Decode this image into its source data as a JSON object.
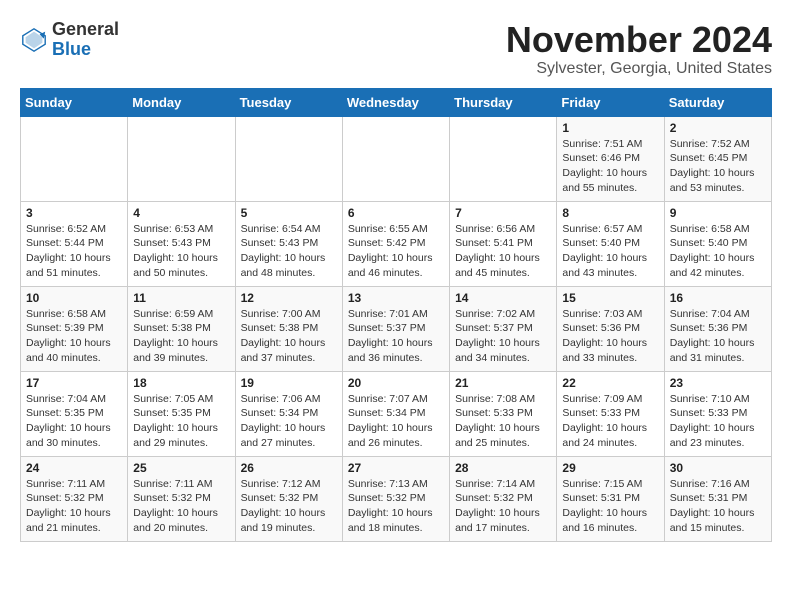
{
  "header": {
    "logo_general": "General",
    "logo_blue": "Blue",
    "title": "November 2024",
    "subtitle": "Sylvester, Georgia, United States"
  },
  "weekdays": [
    "Sunday",
    "Monday",
    "Tuesday",
    "Wednesday",
    "Thursday",
    "Friday",
    "Saturday"
  ],
  "weeks": [
    [
      {
        "day": "",
        "info": ""
      },
      {
        "day": "",
        "info": ""
      },
      {
        "day": "",
        "info": ""
      },
      {
        "day": "",
        "info": ""
      },
      {
        "day": "",
        "info": ""
      },
      {
        "day": "1",
        "info": "Sunrise: 7:51 AM\nSunset: 6:46 PM\nDaylight: 10 hours\nand 55 minutes."
      },
      {
        "day": "2",
        "info": "Sunrise: 7:52 AM\nSunset: 6:45 PM\nDaylight: 10 hours\nand 53 minutes."
      }
    ],
    [
      {
        "day": "3",
        "info": "Sunrise: 6:52 AM\nSunset: 5:44 PM\nDaylight: 10 hours\nand 51 minutes."
      },
      {
        "day": "4",
        "info": "Sunrise: 6:53 AM\nSunset: 5:43 PM\nDaylight: 10 hours\nand 50 minutes."
      },
      {
        "day": "5",
        "info": "Sunrise: 6:54 AM\nSunset: 5:43 PM\nDaylight: 10 hours\nand 48 minutes."
      },
      {
        "day": "6",
        "info": "Sunrise: 6:55 AM\nSunset: 5:42 PM\nDaylight: 10 hours\nand 46 minutes."
      },
      {
        "day": "7",
        "info": "Sunrise: 6:56 AM\nSunset: 5:41 PM\nDaylight: 10 hours\nand 45 minutes."
      },
      {
        "day": "8",
        "info": "Sunrise: 6:57 AM\nSunset: 5:40 PM\nDaylight: 10 hours\nand 43 minutes."
      },
      {
        "day": "9",
        "info": "Sunrise: 6:58 AM\nSunset: 5:40 PM\nDaylight: 10 hours\nand 42 minutes."
      }
    ],
    [
      {
        "day": "10",
        "info": "Sunrise: 6:58 AM\nSunset: 5:39 PM\nDaylight: 10 hours\nand 40 minutes."
      },
      {
        "day": "11",
        "info": "Sunrise: 6:59 AM\nSunset: 5:38 PM\nDaylight: 10 hours\nand 39 minutes."
      },
      {
        "day": "12",
        "info": "Sunrise: 7:00 AM\nSunset: 5:38 PM\nDaylight: 10 hours\nand 37 minutes."
      },
      {
        "day": "13",
        "info": "Sunrise: 7:01 AM\nSunset: 5:37 PM\nDaylight: 10 hours\nand 36 minutes."
      },
      {
        "day": "14",
        "info": "Sunrise: 7:02 AM\nSunset: 5:37 PM\nDaylight: 10 hours\nand 34 minutes."
      },
      {
        "day": "15",
        "info": "Sunrise: 7:03 AM\nSunset: 5:36 PM\nDaylight: 10 hours\nand 33 minutes."
      },
      {
        "day": "16",
        "info": "Sunrise: 7:04 AM\nSunset: 5:36 PM\nDaylight: 10 hours\nand 31 minutes."
      }
    ],
    [
      {
        "day": "17",
        "info": "Sunrise: 7:04 AM\nSunset: 5:35 PM\nDaylight: 10 hours\nand 30 minutes."
      },
      {
        "day": "18",
        "info": "Sunrise: 7:05 AM\nSunset: 5:35 PM\nDaylight: 10 hours\nand 29 minutes."
      },
      {
        "day": "19",
        "info": "Sunrise: 7:06 AM\nSunset: 5:34 PM\nDaylight: 10 hours\nand 27 minutes."
      },
      {
        "day": "20",
        "info": "Sunrise: 7:07 AM\nSunset: 5:34 PM\nDaylight: 10 hours\nand 26 minutes."
      },
      {
        "day": "21",
        "info": "Sunrise: 7:08 AM\nSunset: 5:33 PM\nDaylight: 10 hours\nand 25 minutes."
      },
      {
        "day": "22",
        "info": "Sunrise: 7:09 AM\nSunset: 5:33 PM\nDaylight: 10 hours\nand 24 minutes."
      },
      {
        "day": "23",
        "info": "Sunrise: 7:10 AM\nSunset: 5:33 PM\nDaylight: 10 hours\nand 23 minutes."
      }
    ],
    [
      {
        "day": "24",
        "info": "Sunrise: 7:11 AM\nSunset: 5:32 PM\nDaylight: 10 hours\nand 21 minutes."
      },
      {
        "day": "25",
        "info": "Sunrise: 7:11 AM\nSunset: 5:32 PM\nDaylight: 10 hours\nand 20 minutes."
      },
      {
        "day": "26",
        "info": "Sunrise: 7:12 AM\nSunset: 5:32 PM\nDaylight: 10 hours\nand 19 minutes."
      },
      {
        "day": "27",
        "info": "Sunrise: 7:13 AM\nSunset: 5:32 PM\nDaylight: 10 hours\nand 18 minutes."
      },
      {
        "day": "28",
        "info": "Sunrise: 7:14 AM\nSunset: 5:32 PM\nDaylight: 10 hours\nand 17 minutes."
      },
      {
        "day": "29",
        "info": "Sunrise: 7:15 AM\nSunset: 5:31 PM\nDaylight: 10 hours\nand 16 minutes."
      },
      {
        "day": "30",
        "info": "Sunrise: 7:16 AM\nSunset: 5:31 PM\nDaylight: 10 hours\nand 15 minutes."
      }
    ]
  ]
}
